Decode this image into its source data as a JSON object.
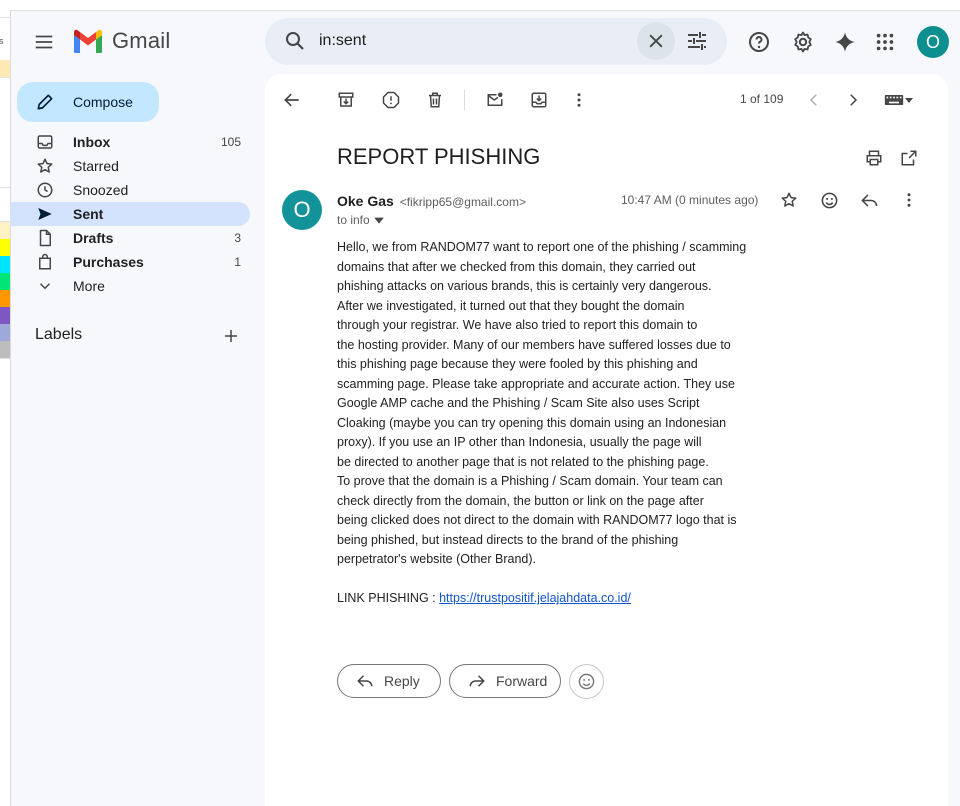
{
  "app": {
    "logo_text": "Gmail"
  },
  "strip": {
    "label": "rs"
  },
  "search": {
    "value": "in:sent"
  },
  "compose": {
    "label": "Compose"
  },
  "nav": {
    "items": [
      {
        "label": "Inbox",
        "count": "105"
      },
      {
        "label": "Starred",
        "count": ""
      },
      {
        "label": "Snoozed",
        "count": ""
      },
      {
        "label": "Sent",
        "count": ""
      },
      {
        "label": "Drafts",
        "count": "3"
      },
      {
        "label": "Purchases",
        "count": "1"
      },
      {
        "label": "More",
        "count": ""
      }
    ],
    "labels_heading": "Labels"
  },
  "profile": {
    "initial": "O"
  },
  "toolbar": {
    "pager": "1 of 109"
  },
  "message": {
    "subject": "REPORT PHISHING",
    "sender_initial": "O",
    "sender_name": "Oke Gas",
    "sender_email": "<fikripp65@gmail.com>",
    "to": "to info",
    "time": "10:47 AM (0 minutes ago)",
    "body_lines": [
      "Hello, we from RANDOM77 want to report one of the phishing / scamming",
      "domains that after we checked from this domain, they carried out",
      "phishing attacks on various brands, this is certainly very dangerous.",
      "After we investigated, it turned out that they bought the domain",
      "through your registrar. We have also tried to report this domain to",
      "the hosting provider. Many of our members have suffered losses due to",
      "this phishing page because they were fooled by this phishing and",
      "scamming page. Please take appropriate and accurate action. They use",
      "Google AMP cache and the Phishing / Scam Site also uses Script",
      "Cloaking (maybe you can try opening this domain using an Indonesian",
      "proxy). If you use an IP other than Indonesia, usually the page will",
      "be directed to another page that is not related to the phishing page.",
      "To prove that the domain is a Phishing / Scam domain. Your team can",
      "check directly from the domain, the button or link on the page after",
      "being clicked does not direct to the domain with RANDOM77 logo that is",
      "being phished, but instead directs to the brand of the phishing",
      "perpetrator's website (Other Brand)."
    ],
    "link_label": "LINK PHISHING : ",
    "link_url": "https://trustpositif.jelajahdata.co.id/"
  },
  "actions": {
    "reply": "Reply",
    "forward": "Forward"
  },
  "colors": {
    "compose_bg": "#c2e7ff",
    "active_nav": "#d3e3fd",
    "avatar": "#0d8f8f",
    "link": "#1155cc"
  }
}
